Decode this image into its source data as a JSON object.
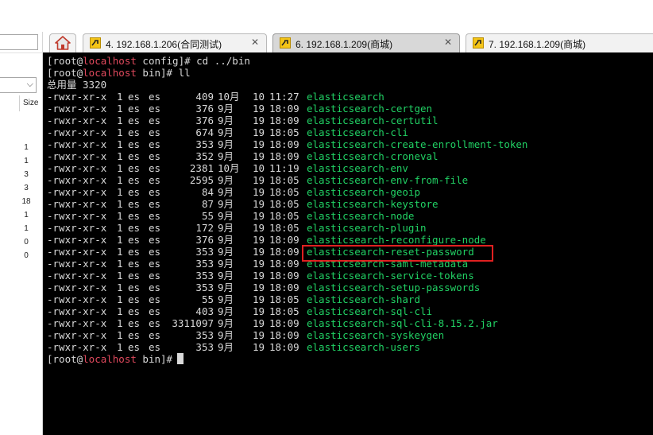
{
  "tabs": [
    {
      "label": "4. 192.168.1.206(合同测试)",
      "close": "✕",
      "active": false
    },
    {
      "label": "6. 192.168.1.209(商城)",
      "close": "✕",
      "active": true
    },
    {
      "label": "7. 192.168.1.209(商城)",
      "close": "✕",
      "active": false
    }
  ],
  "left_panel": {
    "size_header": "Size",
    "sizes": [
      "1",
      "1",
      "3",
      "3",
      "18",
      "1",
      "1",
      "0",
      "0"
    ]
  },
  "terminal": {
    "prompt1": {
      "pre": "[root@",
      "host": "localhost",
      "post": " config]# cd ../bin"
    },
    "prompt2": {
      "pre": "[root@",
      "host": "localhost",
      "post": " bin]# ll"
    },
    "total": "总用量 3320",
    "files": [
      {
        "perm": "-rwxr-xr-x",
        "links": "1",
        "user": "es",
        "group": "es",
        "size": "409",
        "month": "10月",
        "day": "10",
        "time": "11:27",
        "name": "elasticsearch"
      },
      {
        "perm": "-rwxr-xr-x",
        "links": "1",
        "user": "es",
        "group": "es",
        "size": "376",
        "month": "9月",
        "day": "19",
        "time": "18:09",
        "name": "elasticsearch-certgen"
      },
      {
        "perm": "-rwxr-xr-x",
        "links": "1",
        "user": "es",
        "group": "es",
        "size": "376",
        "month": "9月",
        "day": "19",
        "time": "18:09",
        "name": "elasticsearch-certutil"
      },
      {
        "perm": "-rwxr-xr-x",
        "links": "1",
        "user": "es",
        "group": "es",
        "size": "674",
        "month": "9月",
        "day": "19",
        "time": "18:05",
        "name": "elasticsearch-cli"
      },
      {
        "perm": "-rwxr-xr-x",
        "links": "1",
        "user": "es",
        "group": "es",
        "size": "353",
        "month": "9月",
        "day": "19",
        "time": "18:09",
        "name": "elasticsearch-create-enrollment-token"
      },
      {
        "perm": "-rwxr-xr-x",
        "links": "1",
        "user": "es",
        "group": "es",
        "size": "352",
        "month": "9月",
        "day": "19",
        "time": "18:09",
        "name": "elasticsearch-croneval"
      },
      {
        "perm": "-rwxr-xr-x",
        "links": "1",
        "user": "es",
        "group": "es",
        "size": "2381",
        "month": "10月",
        "day": "10",
        "time": "11:19",
        "name": "elasticsearch-env"
      },
      {
        "perm": "-rwxr-xr-x",
        "links": "1",
        "user": "es",
        "group": "es",
        "size": "2595",
        "month": "9月",
        "day": "19",
        "time": "18:05",
        "name": "elasticsearch-env-from-file"
      },
      {
        "perm": "-rwxr-xr-x",
        "links": "1",
        "user": "es",
        "group": "es",
        "size": "84",
        "month": "9月",
        "day": "19",
        "time": "18:05",
        "name": "elasticsearch-geoip"
      },
      {
        "perm": "-rwxr-xr-x",
        "links": "1",
        "user": "es",
        "group": "es",
        "size": "87",
        "month": "9月",
        "day": "19",
        "time": "18:05",
        "name": "elasticsearch-keystore"
      },
      {
        "perm": "-rwxr-xr-x",
        "links": "1",
        "user": "es",
        "group": "es",
        "size": "55",
        "month": "9月",
        "day": "19",
        "time": "18:05",
        "name": "elasticsearch-node"
      },
      {
        "perm": "-rwxr-xr-x",
        "links": "1",
        "user": "es",
        "group": "es",
        "size": "172",
        "month": "9月",
        "day": "19",
        "time": "18:05",
        "name": "elasticsearch-plugin"
      },
      {
        "perm": "-rwxr-xr-x",
        "links": "1",
        "user": "es",
        "group": "es",
        "size": "376",
        "month": "9月",
        "day": "19",
        "time": "18:09",
        "name": "elasticsearch-reconfigure-node"
      },
      {
        "perm": "-rwxr-xr-x",
        "links": "1",
        "user": "es",
        "group": "es",
        "size": "353",
        "month": "9月",
        "day": "19",
        "time": "18:09",
        "name": "elasticsearch-reset-password"
      },
      {
        "perm": "-rwxr-xr-x",
        "links": "1",
        "user": "es",
        "group": "es",
        "size": "353",
        "month": "9月",
        "day": "19",
        "time": "18:09",
        "name": "elasticsearch-saml-metadata"
      },
      {
        "perm": "-rwxr-xr-x",
        "links": "1",
        "user": "es",
        "group": "es",
        "size": "353",
        "month": "9月",
        "day": "19",
        "time": "18:09",
        "name": "elasticsearch-service-tokens"
      },
      {
        "perm": "-rwxr-xr-x",
        "links": "1",
        "user": "es",
        "group": "es",
        "size": "353",
        "month": "9月",
        "day": "19",
        "time": "18:09",
        "name": "elasticsearch-setup-passwords"
      },
      {
        "perm": "-rwxr-xr-x",
        "links": "1",
        "user": "es",
        "group": "es",
        "size": "55",
        "month": "9月",
        "day": "19",
        "time": "18:05",
        "name": "elasticsearch-shard"
      },
      {
        "perm": "-rwxr-xr-x",
        "links": "1",
        "user": "es",
        "group": "es",
        "size": "403",
        "month": "9月",
        "day": "19",
        "time": "18:05",
        "name": "elasticsearch-sql-cli"
      },
      {
        "perm": "-rwxr-xr-x",
        "links": "1",
        "user": "es",
        "group": "es",
        "size": "3311097",
        "month": "9月",
        "day": "19",
        "time": "18:09",
        "name": "elasticsearch-sql-cli-8.15.2.jar"
      },
      {
        "perm": "-rwxr-xr-x",
        "links": "1",
        "user": "es",
        "group": "es",
        "size": "353",
        "month": "9月",
        "day": "19",
        "time": "18:09",
        "name": "elasticsearch-syskeygen"
      },
      {
        "perm": "-rwxr-xr-x",
        "links": "1",
        "user": "es",
        "group": "es",
        "size": "353",
        "month": "9月",
        "day": "19",
        "time": "18:09",
        "name": "elasticsearch-users"
      }
    ],
    "prompt3": {
      "pre": "[root@",
      "host": "localhost",
      "post": " bin]#"
    }
  },
  "colors": {
    "terminal_bg": "#000000",
    "terminal_text": "#d9d9d9",
    "host": "#e0495d",
    "executable": "#21d164",
    "highlight": "#e02020"
  }
}
